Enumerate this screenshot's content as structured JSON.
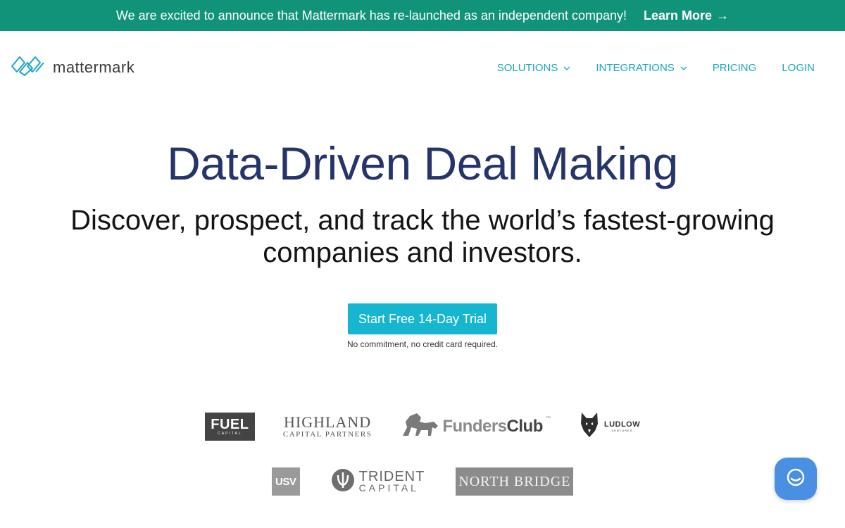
{
  "announcement": {
    "message": "We are excited to announce that Mattermark has re-launched as an independent company!",
    "link_label": "Learn More",
    "link_arrow": "→",
    "background": "#11937a"
  },
  "nav": {
    "logo_text": "mattermark",
    "logo_icon": "mattermark-logo-icon",
    "items": [
      {
        "label": "SOLUTIONS",
        "has_dropdown": true,
        "chevron": "⌄"
      },
      {
        "label": "INTEGRATIONS",
        "has_dropdown": true,
        "chevron": "⌄"
      },
      {
        "label": "PRICING",
        "has_dropdown": false
      },
      {
        "label": "LOGIN",
        "has_dropdown": false
      }
    ],
    "link_color": "#1aa7bf"
  },
  "hero": {
    "title": "Data-Driven Deal Making",
    "subtitle": "Discover, prospect, and track the world’s fastest-growing companies and investors.",
    "cta_label": "Start Free 14-Day Trial",
    "cta_note": "No commitment, no credit card required.",
    "title_color": "#25346b",
    "cta_color": "#17b6d0"
  },
  "customer_logos": {
    "row1": [
      {
        "name": "FUEL",
        "sub": "CAPITAL"
      },
      {
        "name": "HIGHLAND",
        "sub": "CAPITAL PARTNERS"
      },
      {
        "name_a": "Funders",
        "name_b": "Club",
        "tm": "™"
      },
      {
        "name": "LUDLOW",
        "sub": "VENTURES"
      }
    ],
    "row2": [
      {
        "name": "USV"
      },
      {
        "name": "TRIDENT",
        "sub": "CAPITAL"
      },
      {
        "name": "NORTH BRIDGE"
      }
    ]
  },
  "chat_widget": {
    "icon": "chat-bubble-icon",
    "color": "#4a90e2"
  }
}
